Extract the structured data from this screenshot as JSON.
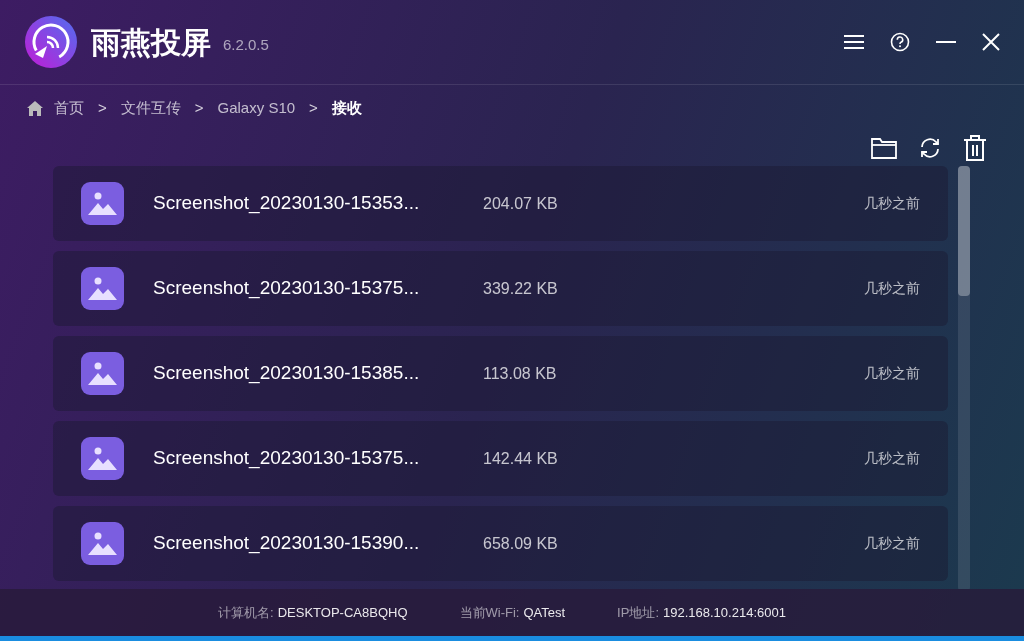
{
  "app": {
    "title": "雨燕投屏",
    "version": "6.2.0.5"
  },
  "breadcrumb": [
    {
      "label": "首页",
      "current": false
    },
    {
      "label": "文件互传",
      "current": false
    },
    {
      "label": "Galaxy S10",
      "current": false
    },
    {
      "label": "接收",
      "current": true
    }
  ],
  "breadcrumb_separator": ">",
  "files": [
    {
      "name": "Screenshot_20230130-15353...",
      "size": "204.07 KB",
      "time": "几秒之前"
    },
    {
      "name": "Screenshot_20230130-15375...",
      "size": "339.22 KB",
      "time": "几秒之前"
    },
    {
      "name": "Screenshot_20230130-15385...",
      "size": "113.08 KB",
      "time": "几秒之前"
    },
    {
      "name": "Screenshot_20230130-15375...",
      "size": "142.44 KB",
      "time": "几秒之前"
    },
    {
      "name": "Screenshot_20230130-15390...",
      "size": "658.09 KB",
      "time": "几秒之前"
    }
  ],
  "status_bar": [
    {
      "label": "计算机名:",
      "value": "DESKTOP-CA8BQHQ"
    },
    {
      "label": "当前Wi-Fi:",
      "value": "QATest"
    },
    {
      "label": "IP地址:",
      "value": "192.168.10.214:6001"
    }
  ]
}
